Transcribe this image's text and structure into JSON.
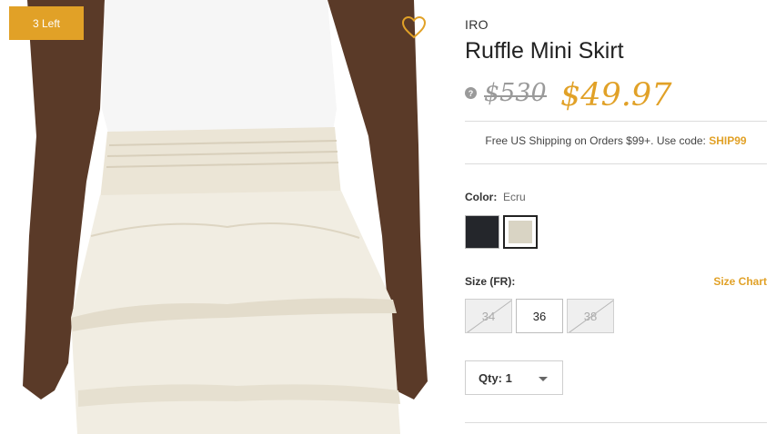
{
  "product": {
    "stock_badge": "3 Left",
    "brand": "IRO",
    "title": "Ruffle Mini Skirt",
    "original_price": "$530",
    "sale_price": "$49.97",
    "help_icon": "?",
    "wishlist_icon": "heart-outline-icon"
  },
  "shipping": {
    "text": "Free US Shipping on Orders $99+. Use code: ",
    "code": "SHIP99"
  },
  "color": {
    "label": "Color:",
    "selected": "Ecru",
    "swatches": [
      "black",
      "ecru"
    ]
  },
  "size": {
    "label": "Size (FR):",
    "chart_link": "Size Chart",
    "options": [
      {
        "label": "34",
        "available": false
      },
      {
        "label": "36",
        "available": true,
        "selected": true
      },
      {
        "label": "38",
        "available": false
      }
    ]
  },
  "quantity": {
    "label": "Qty: 1"
  },
  "colors": {
    "accent": "#e1a127",
    "muted": "#9a9a9a"
  }
}
